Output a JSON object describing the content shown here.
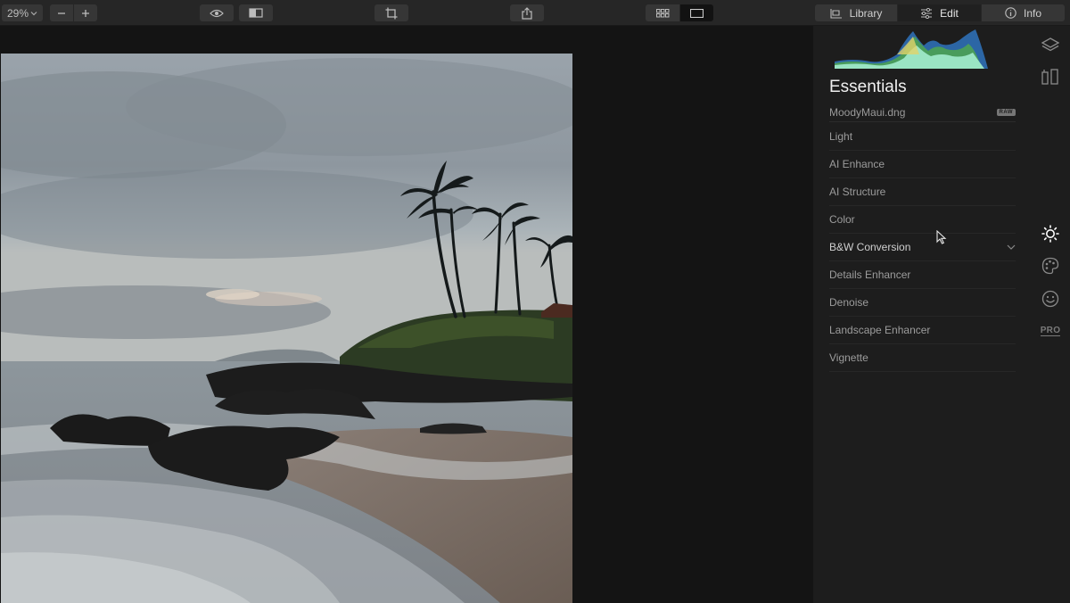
{
  "toolbar": {
    "zoom_value": "29%",
    "zoom_out_icon": "minus-icon",
    "zoom_in_icon": "plus-icon",
    "preview_icon": "eye-icon",
    "compare_icon": "compare-split-icon",
    "crop_icon": "crop-icon",
    "share_icon": "share-icon",
    "grid_view_icon": "grid-icon",
    "single_view_icon": "single-view-icon"
  },
  "tabs": [
    {
      "label": "Library",
      "icon": "library-icon"
    },
    {
      "label": "Edit",
      "icon": "sliders-icon"
    },
    {
      "label": "Info",
      "icon": "info-icon"
    }
  ],
  "panel": {
    "title": "Essentials",
    "file_name": "MoodyMaui.dng",
    "raw_badge": "RAW",
    "tools": [
      {
        "label": "Light"
      },
      {
        "label": "AI Enhance"
      },
      {
        "label": "AI Structure"
      },
      {
        "label": "Color"
      },
      {
        "label": "B&W Conversion"
      },
      {
        "label": "Details Enhancer"
      },
      {
        "label": "Denoise"
      },
      {
        "label": "Landscape Enhancer"
      },
      {
        "label": "Vignette"
      }
    ]
  },
  "side_icons": {
    "layers": "layers-icon",
    "presets": "presets-icon",
    "essentials": "sun-icon",
    "creative": "palette-icon",
    "portrait": "smile-icon",
    "pro_label": "PRO"
  },
  "colors": {
    "toolbar_bg": "#262626",
    "panel_bg": "#1d1d1d",
    "canvas_bg": "#141414",
    "accent_text": "#f0f0f0"
  }
}
